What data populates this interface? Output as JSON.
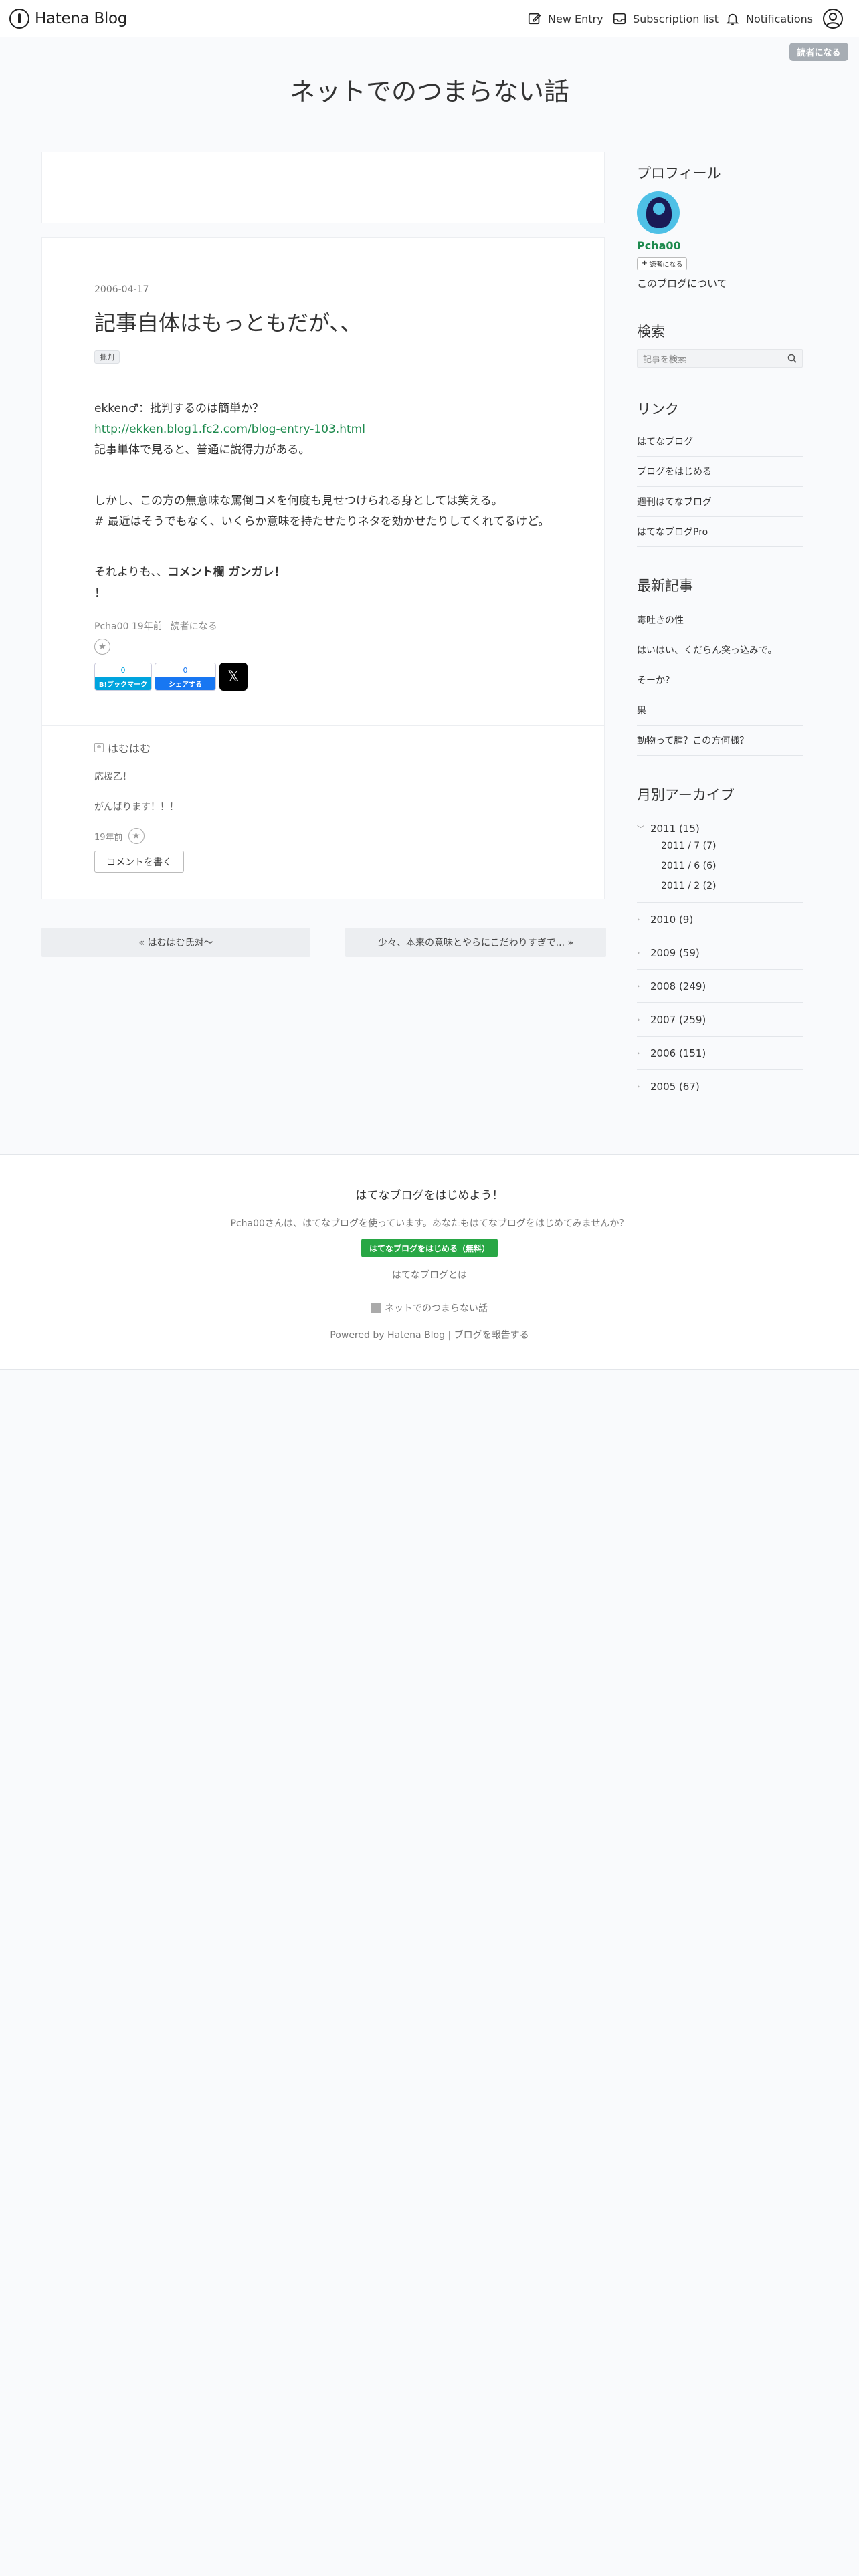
{
  "topbar": {
    "logo_text": "Hatena Blog",
    "new_entry": "New Entry",
    "subscription": "Subscription list",
    "notifications": "Notifications"
  },
  "reader_button": "読者になる",
  "blog_title": "ネットでのつまらない話",
  "entry": {
    "date": "2006-04-17",
    "title": "記事自体はもっともだが、、",
    "category": "批判",
    "p1_line1": "ekken♂：批判するのは簡単か？",
    "p1_link": "http://ekken.blog1.fc2.com/blog-entry-103.html",
    "p1_line3": "記事単体で見ると、普通に説得力がある。",
    "p2_line1": "しかし、この方の無意味な罵倒コメを何度も見せつけられる身としては笑える。",
    "p2_line2": "# 最近はそうでもなく、いくらか意味を持たせたりネタを効かせたりしてくれてるけど。",
    "p3_prefix": "それよりも、、",
    "p3_bold": "コメント欄 ガンガレ！",
    "p3_line2": "！",
    "author": "Pcha00",
    "ago": "19年前",
    "reader_link": "読者になる",
    "hatena_count": "0",
    "hatena_label": "B!ブックマーク",
    "fb_count": "0",
    "fb_label": "シェアする",
    "x_label": "𝕏"
  },
  "comment": {
    "author": "はむはむ",
    "line1": "応援乙！",
    "line2": "がんばります！！！",
    "time": "19年前",
    "write_button": "コメントを書く"
  },
  "pager": {
    "prev": "« はむはむ氏対〜",
    "next": "少々、本来の意味とやらにこだわりすぎで... »"
  },
  "sidebar": {
    "profile_h": "プロフィール",
    "name": "Pcha00",
    "reader": "読者になる",
    "about": "このブログについて",
    "search_h": "検索",
    "search_placeholder": "記事を検索",
    "links_h": "リンク",
    "links": [
      "はてなブログ",
      "ブログをはじめる",
      "週刊はてなブログ",
      "はてなブログPro"
    ],
    "recent_h": "最新記事",
    "recent": [
      "毒吐きの性",
      "はいはい、くだらん突っ込みで。",
      "そーか？",
      "果",
      "動物って腫？この方何様？"
    ],
    "archive_h": "月別アーカイブ",
    "archive_2011": "2011 (15)",
    "archive_2011_months": [
      "2011 / 7 (7)",
      "2011 / 6 (6)",
      "2011 / 2 (2)"
    ],
    "archive_years": [
      "2010 (9)",
      "2009 (59)",
      "2008 (249)",
      "2007 (259)",
      "2006 (151)",
      "2005 (67)"
    ]
  },
  "footer": {
    "heading": "はてなブログをはじめよう！",
    "desc": "Pcha00さんは、はてなブログを使っています。あなたもはてなブログをはじめてみませんか？",
    "cta": "はてなブログをはじめる（無料）",
    "about": "はてなブログとは",
    "blog_name": "ネットでのつまらない話",
    "powered": "Powered by Hatena Blog | ブログを報告する"
  },
  "colors": {
    "accent_green": "#1e8a4e",
    "cta_green": "#28a745",
    "hatena_blue": "#00a4de",
    "facebook_blue": "#1877f2"
  }
}
